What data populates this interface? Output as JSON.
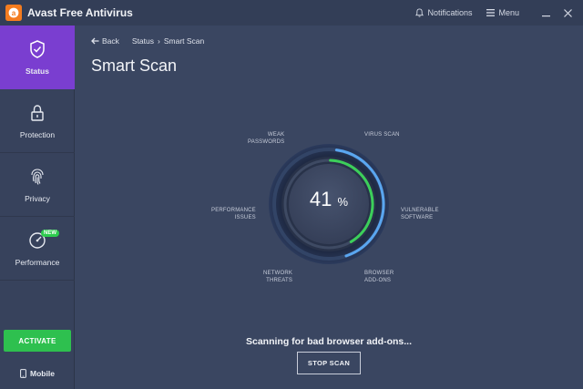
{
  "app": {
    "title": "Avast Free Antivirus"
  },
  "titlebar": {
    "notifications": "Notifications",
    "menu": "Menu"
  },
  "sidebar": {
    "items": [
      {
        "label": "Status",
        "icon": "shield-check-icon",
        "active": true
      },
      {
        "label": "Protection",
        "icon": "lock-icon",
        "active": false
      },
      {
        "label": "Privacy",
        "icon": "fingerprint-icon",
        "active": false
      },
      {
        "label": "Performance",
        "icon": "speedometer-icon",
        "active": false,
        "badge": "NEW"
      }
    ],
    "activate": "ACTIVATE",
    "mobile": "Mobile"
  },
  "main": {
    "back": "Back",
    "breadcrumb": [
      "Status",
      "Smart Scan"
    ],
    "breadcrumb_sep": "›",
    "title": "Smart Scan",
    "progress": {
      "value": "41",
      "unit": "%",
      "fraction": 0.41
    },
    "scan_labels": {
      "weak_passwords": [
        "WEAK",
        "PASSWORDS"
      ],
      "virus_scan": [
        "VIRUS SCAN"
      ],
      "performance_issues": [
        "PERFORMANCE",
        "ISSUES"
      ],
      "vulnerable_software": [
        "VULNERABLE",
        "SOFTWARE"
      ],
      "network_threats": [
        "NETWORK",
        "THREATS"
      ],
      "browser_addons": [
        "BROWSER",
        "ADD-ONS"
      ]
    },
    "status_text": "Scanning for bad browser add-ons...",
    "stop_button": "STOP SCAN"
  },
  "colors": {
    "accent_purple": "#7a3ed0",
    "activate_green": "#2ec04f",
    "progress_green": "#3ccf5a",
    "ring_blue": "#5aa6f0",
    "background": "#3a4661"
  }
}
